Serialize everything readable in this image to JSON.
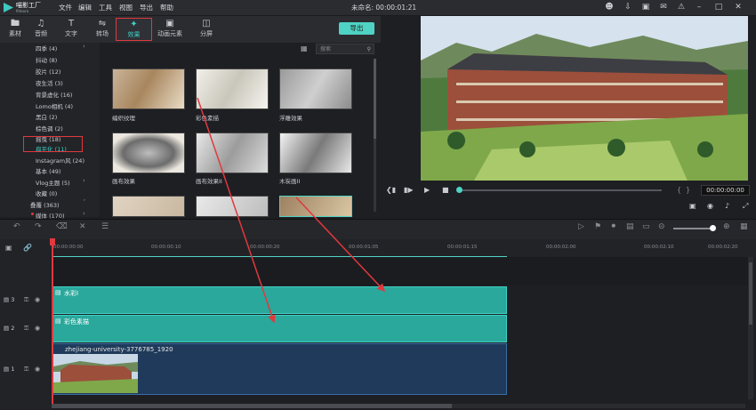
{
  "app": {
    "logo_name": "喵影工厂",
    "logo_sub": "filmora",
    "project_title": "未命名: 00:00:01:21"
  },
  "menu": [
    "文件",
    "编辑",
    "工具",
    "视图",
    "导出",
    "帮助"
  ],
  "window_icons": [
    "user-icon",
    "download-icon",
    "cart-icon",
    "mail-icon",
    "notification-icon",
    "minimize-icon",
    "maximize-icon",
    "close-icon"
  ],
  "tabs": [
    {
      "label": "素材",
      "icon": "folder-icon"
    },
    {
      "label": "音频",
      "icon": "music-icon"
    },
    {
      "label": "文字",
      "icon": "text-icon"
    },
    {
      "label": "转场",
      "icon": "transition-icon"
    },
    {
      "label": "效果",
      "icon": "effects-icon",
      "active": true
    },
    {
      "label": "动画元素",
      "icon": "elements-icon"
    },
    {
      "label": "分屏",
      "icon": "split-screen-icon"
    }
  ],
  "export_label": "导出",
  "search": {
    "placeholder": "搜索"
  },
  "tree": [
    "四季 (4)",
    "抖动 (8)",
    "胶片 (12)",
    "夜生活 (3)",
    "背景虚化 (16)",
    "Lomo相机 (4)",
    "黑白 (2)",
    "棕色调 (2)",
    "摇曳 (18)",
    "扁平化 (11)",
    "Instagram风 (24)",
    "基本 (49)",
    "Vlog主题 (5)",
    "收藏 (0)",
    "叠覆 (363)",
    "媒体 (170)"
  ],
  "effects": [
    {
      "label": "编织纹理"
    },
    {
      "label": "彩色素描"
    },
    {
      "label": "浮雕效果"
    },
    {
      "label": "画布效果"
    },
    {
      "label": "画布效果II"
    },
    {
      "label": "木炭画II"
    },
    {
      "label": ""
    },
    {
      "label": ""
    },
    {
      "label": ""
    }
  ],
  "preview": {
    "timecode": "00:00:00:00"
  },
  "ruler": [
    "00:00:00:00",
    "00:00:00:10",
    "00:00:00:20",
    "00:00:01:05",
    "00:00:01:15",
    "00:00:02:00",
    "00:00:02:10",
    "00:00:02:20"
  ],
  "tracks": [
    {
      "num": "3",
      "clip": "水彩I"
    },
    {
      "num": "2",
      "clip": "彩色素描"
    },
    {
      "num": "1",
      "clip": "zhejiang-university-3776785_1920"
    }
  ],
  "colors": {
    "accent": "#4fd3c4",
    "highlight": "#e0393e",
    "clip": "#2aa89c",
    "video_clip": "#1f3a5a"
  }
}
